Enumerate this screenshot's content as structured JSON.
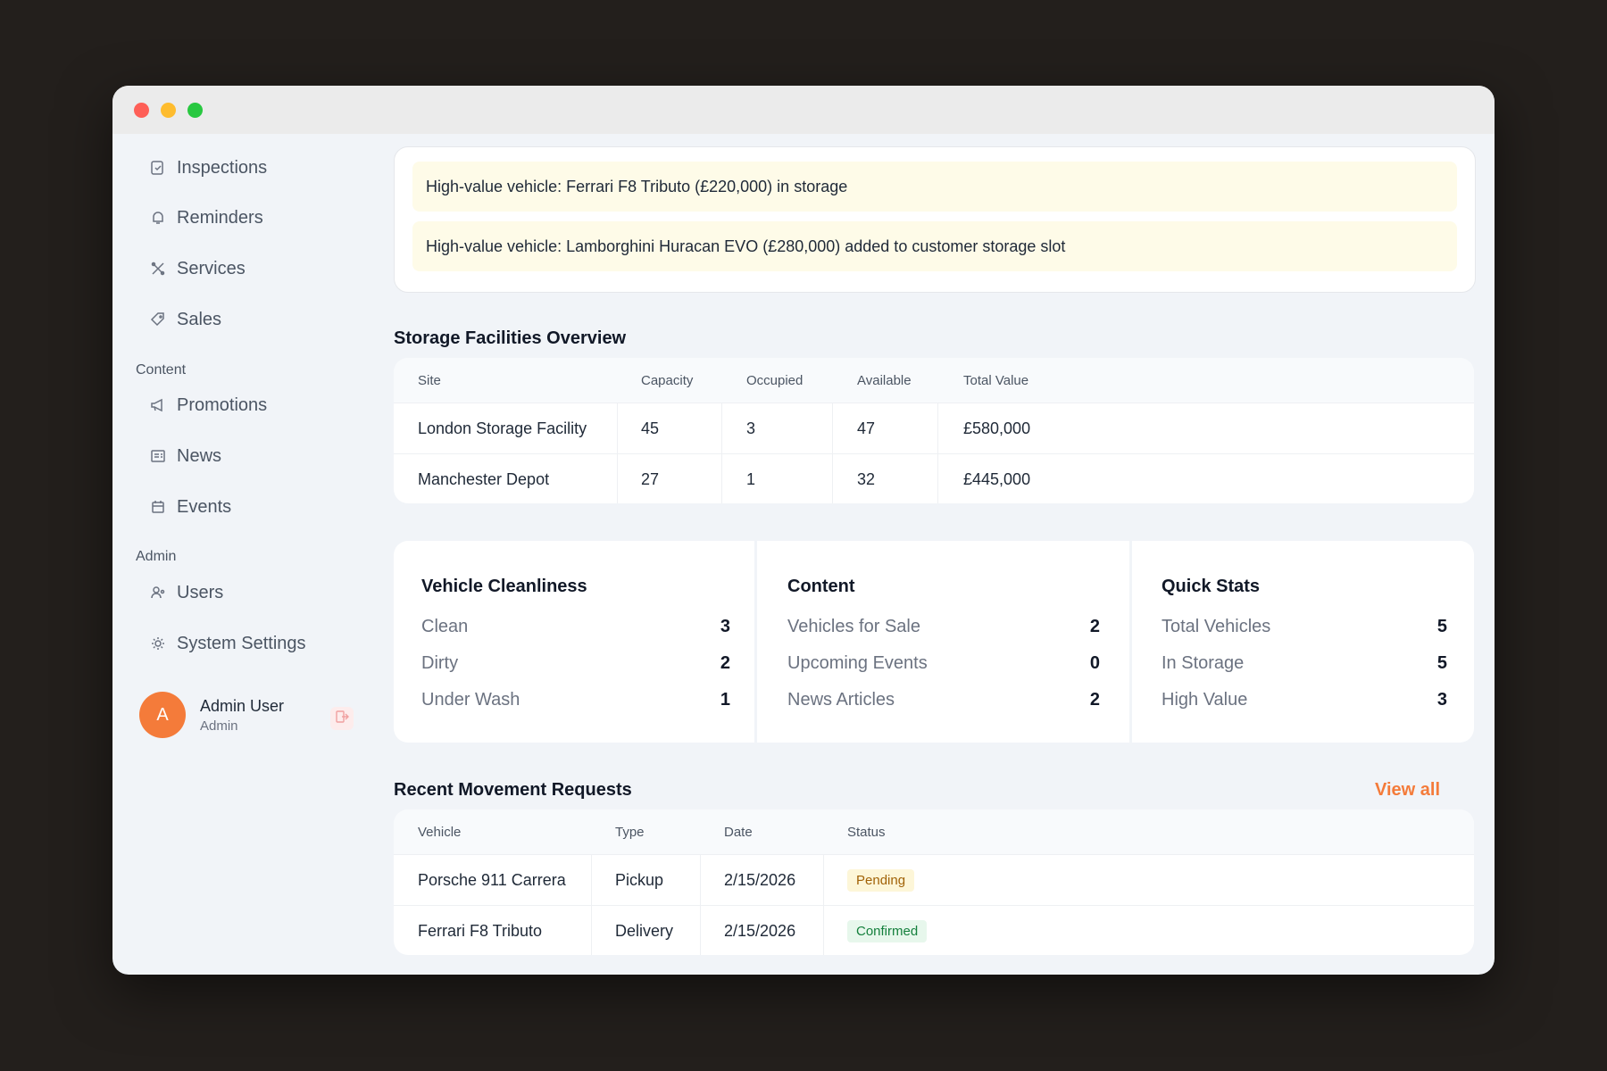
{
  "sidebar": {
    "items": [
      {
        "label": "Inspections",
        "icon": "clipboard-check-icon"
      },
      {
        "label": "Reminders",
        "icon": "bell-icon"
      },
      {
        "label": "Services",
        "icon": "wrench-icon"
      },
      {
        "label": "Sales",
        "icon": "tag-icon"
      }
    ],
    "content_section": "Content",
    "content_items": [
      {
        "label": "Promotions",
        "icon": "megaphone-icon"
      },
      {
        "label": "News",
        "icon": "newspaper-icon"
      },
      {
        "label": "Events",
        "icon": "calendar-icon"
      }
    ],
    "admin_section": "Admin",
    "admin_items": [
      {
        "label": "Users",
        "icon": "users-icon"
      },
      {
        "label": "System Settings",
        "icon": "gear-icon"
      }
    ],
    "user": {
      "initial": "A",
      "name": "Admin User",
      "role": "Admin"
    }
  },
  "alerts": [
    "High-value vehicle: Ferrari F8 Tributo (£220,000) in storage",
    "High-value vehicle: Lamborghini Huracan EVO (£280,000) added to customer storage slot"
  ],
  "storage": {
    "title": "Storage Facilities Overview",
    "headers": [
      "Site",
      "Capacity",
      "Occupied",
      "Available",
      "Total Value"
    ],
    "rows": [
      [
        "London Storage Facility",
        "45",
        "3",
        "47",
        "£580,000"
      ],
      [
        "Manchester Depot",
        "27",
        "1",
        "32",
        "£445,000"
      ]
    ]
  },
  "cleanliness": {
    "title": "Vehicle Cleanliness",
    "rows": [
      [
        "Clean",
        "3"
      ],
      [
        "Dirty",
        "2"
      ],
      [
        "Under Wash",
        "1"
      ]
    ]
  },
  "content": {
    "title": "Content",
    "rows": [
      [
        "Vehicles for Sale",
        "2"
      ],
      [
        "Upcoming Events",
        "0"
      ],
      [
        "News Articles",
        "2"
      ]
    ]
  },
  "quick_stats": {
    "title": "Quick Stats",
    "rows": [
      [
        "Total Vehicles",
        "5"
      ],
      [
        "In Storage",
        "5"
      ],
      [
        "High Value",
        "3"
      ]
    ]
  },
  "movements": {
    "title": "Recent Movement Requests",
    "view_all": "View all",
    "headers": [
      "Vehicle",
      "Type",
      "Date",
      "Status"
    ],
    "rows": [
      [
        "Porsche 911 Carrera",
        "Pickup",
        "2/15/2026",
        "Pending"
      ],
      [
        "Ferrari F8 Tributo",
        "Delivery",
        "2/15/2026",
        "Confirmed"
      ]
    ]
  },
  "colors": {
    "accent": "#f47b3a",
    "alert_bg": "#fefbe8",
    "pending": "#a16207",
    "confirmed": "#15803d"
  }
}
